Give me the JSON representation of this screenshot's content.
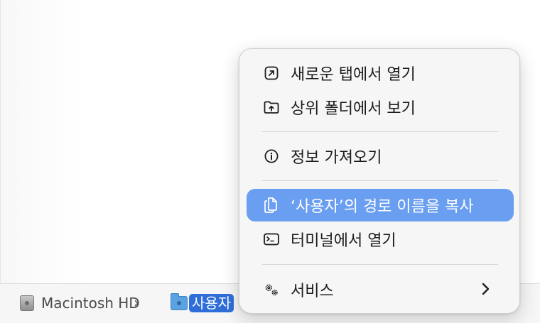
{
  "pathbar": {
    "volume": "Macintosh HD",
    "separator": "›",
    "folder": "사용자"
  },
  "menu": {
    "items": [
      {
        "label": "새로운 탭에서 열기",
        "icon": "open-in-new-tab-icon"
      },
      {
        "label": "상위 폴더에서 보기",
        "icon": "folder-upload-icon"
      },
      {
        "label": "정보 가져오기",
        "icon": "info-icon"
      },
      {
        "label": "‘사용자’의 경로 이름을 복사",
        "icon": "copy-path-icon",
        "highlighted": true
      },
      {
        "label": "터미널에서 열기",
        "icon": "terminal-icon"
      },
      {
        "label": "서비스",
        "icon": "gears-icon",
        "submenu": true
      }
    ],
    "highlight_color": "#6a9ef0"
  }
}
